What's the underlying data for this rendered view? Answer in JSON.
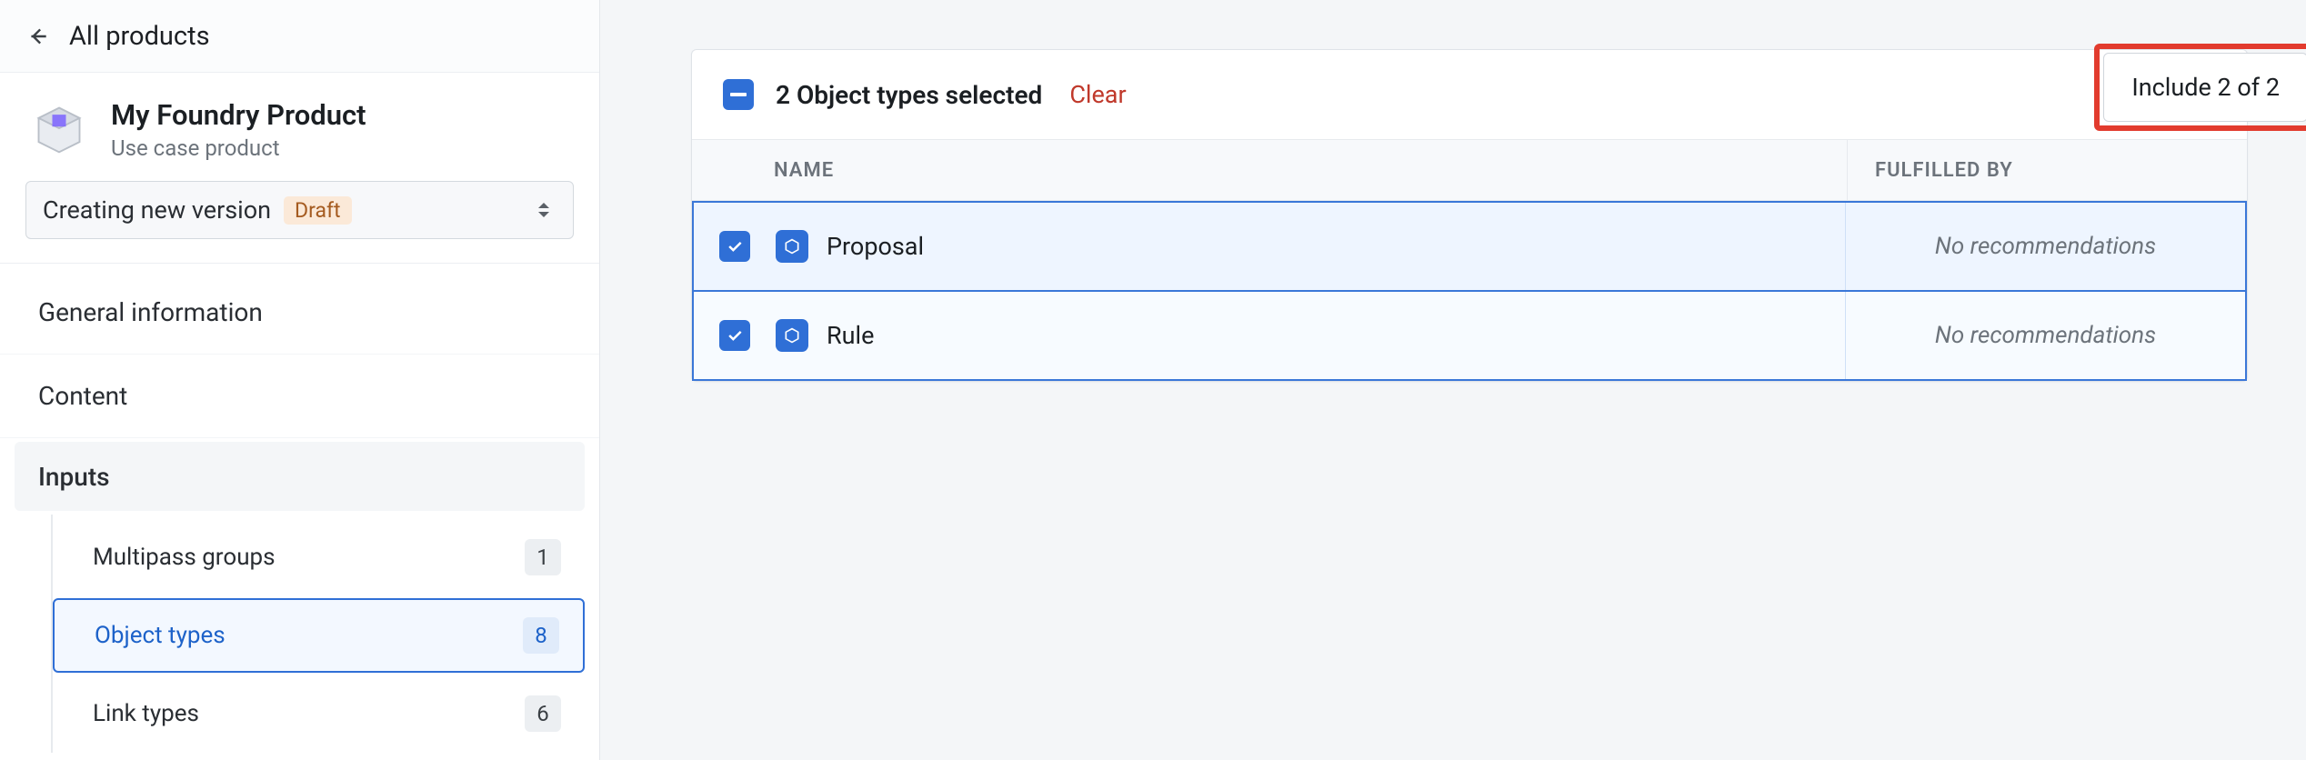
{
  "sidebar": {
    "back_label": "All products",
    "product": {
      "title": "My Foundry Product",
      "subtitle": "Use case product"
    },
    "version": {
      "label": "Creating new version",
      "badge": "Draft"
    },
    "nav": {
      "general": "General information",
      "content": "Content",
      "inputs": "Inputs",
      "sub": {
        "multipass": {
          "label": "Multipass groups",
          "count": "1"
        },
        "object": {
          "label": "Object types",
          "count": "8"
        },
        "link": {
          "label": "Link types",
          "count": "6"
        }
      }
    }
  },
  "panel": {
    "selection_text": "2 Object types selected",
    "clear": "Clear",
    "include": "Include 2 of 2",
    "columns": {
      "name": "NAME",
      "fulfilled": "FULFILLED BY"
    },
    "rows": [
      {
        "name": "Proposal",
        "fulfilled": "No recommendations"
      },
      {
        "name": "Rule",
        "fulfilled": "No recommendations"
      }
    ]
  }
}
